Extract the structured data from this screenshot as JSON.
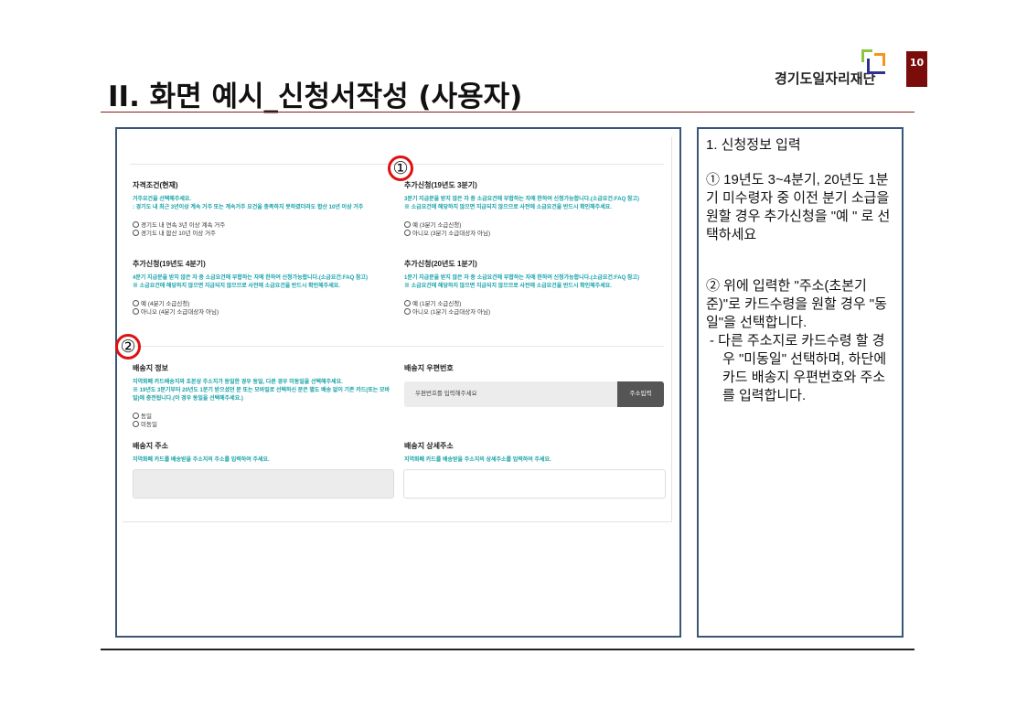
{
  "header": {
    "title": "II. 화면 예시_신청서작성 (사용자)",
    "logo_text": "경기도일자리재단",
    "page_number": "10"
  },
  "form": {
    "qualification": {
      "heading": "자격조건(현재)",
      "desc": "거주요건을 선택해주세요.\n: 경기도 내 최근 3년이상 계속 거주 또는 계속거주 요건을 충족하지 못하였더라도 합산 10년 이상 거주",
      "options": [
        "경기도 내 연속 3년 이상 계속 거주",
        "경기도 내 합산 10년 이상 거주"
      ]
    },
    "extra_19q3": {
      "heading": "추가신청(19년도 3분기)",
      "desc": "3분기 지급분을 받지 않은 자 중 소급요건에 부합하는 자에 한하여 신청가능합니다.(소급요건:FAQ 참고)\n※ 소급요건에 해당하지 않으면 지급되지 않으므로 사전에 소급요건을 반드시 확인해주세요.",
      "options": [
        "예 (3분기 소급신청)",
        "아니오 (3분기 소급대상자 아님)"
      ]
    },
    "extra_19q4": {
      "heading": "추가신청(19년도 4분기)",
      "desc": "4분기 지급분을 받지 않은 자 중 소급요건에 부합하는 자에 한하여 신청가능합니다.(소급요건:FAQ 참고)\n※ 소급요건에 해당하지 않으면 지급되지 않으므로 사전에 소급요건을 반드시 확인해주세요.",
      "options": [
        "예 (4분기 소급신청)",
        "아니오 (4분기 소급대상자 아님)"
      ]
    },
    "extra_20q1": {
      "heading": "추가신청(20년도 1분기)",
      "desc": "1분기 지급분을 받지 않은 자 중 소급요건에 부합하는 자에 한하여 신청가능합니다.(소급요건:FAQ 참고)\n※ 소급요건에 해당하지 않으면 지급되지 않으므로 사전에 소급요건을 반드시 확인해주세요.",
      "options": [
        "예 (1분기 소급신청)",
        "아니오 (1분기 소급대상자 아님)"
      ]
    },
    "delivery_info": {
      "heading": "배송지 정보",
      "desc": "지역화폐 카드배송지와 초본상 주소지가 동일한 경우 동일, 다른 경우 미동일을 선택해주세요.\n※ 19년도 3분기부터 20년도 1분기 받으셨던 분 또는 모바일로 선택하신 분은 별도 배송 없이 기존 카드(또는 모바일)에 충전됩니다.(이 경우 동일을 선택해주세요.)",
      "options": [
        "동일",
        "미동일"
      ]
    },
    "delivery_zip": {
      "heading": "배송지 우편번호",
      "placeholder": "우편번호를 입력해주세요",
      "button": "주소입력"
    },
    "delivery_addr": {
      "heading": "배송지 주소",
      "desc": "지역화폐 카드를 배송받을 주소지의 주소를 입력하여 주세요."
    },
    "delivery_detail": {
      "heading": "배송지 상세주소",
      "desc": "지역화폐 카드를 배송받을 주소지의 상세주소를 입력하여 주세요."
    }
  },
  "markers": [
    "①",
    "②"
  ],
  "side": {
    "title": "1.  신청정보 입력",
    "note1": "① 19년도 3~4분기, 20년도 1분기 미수령자 중 이전 분기 소급을 원할 경우 추가신청을 \"예 \" 로 선택하세요",
    "note2": "② 위에 입력한 \"주소(초본기준)\"로 카드수령을 원할 경우 \"동일\"을 선택합니다.",
    "note3": "-  다른 주소지로 카드수령 할 경우 \"미동일\" 선택하며, 하단에 카드 배송지 우편번호와 주소를 입력합니다."
  }
}
